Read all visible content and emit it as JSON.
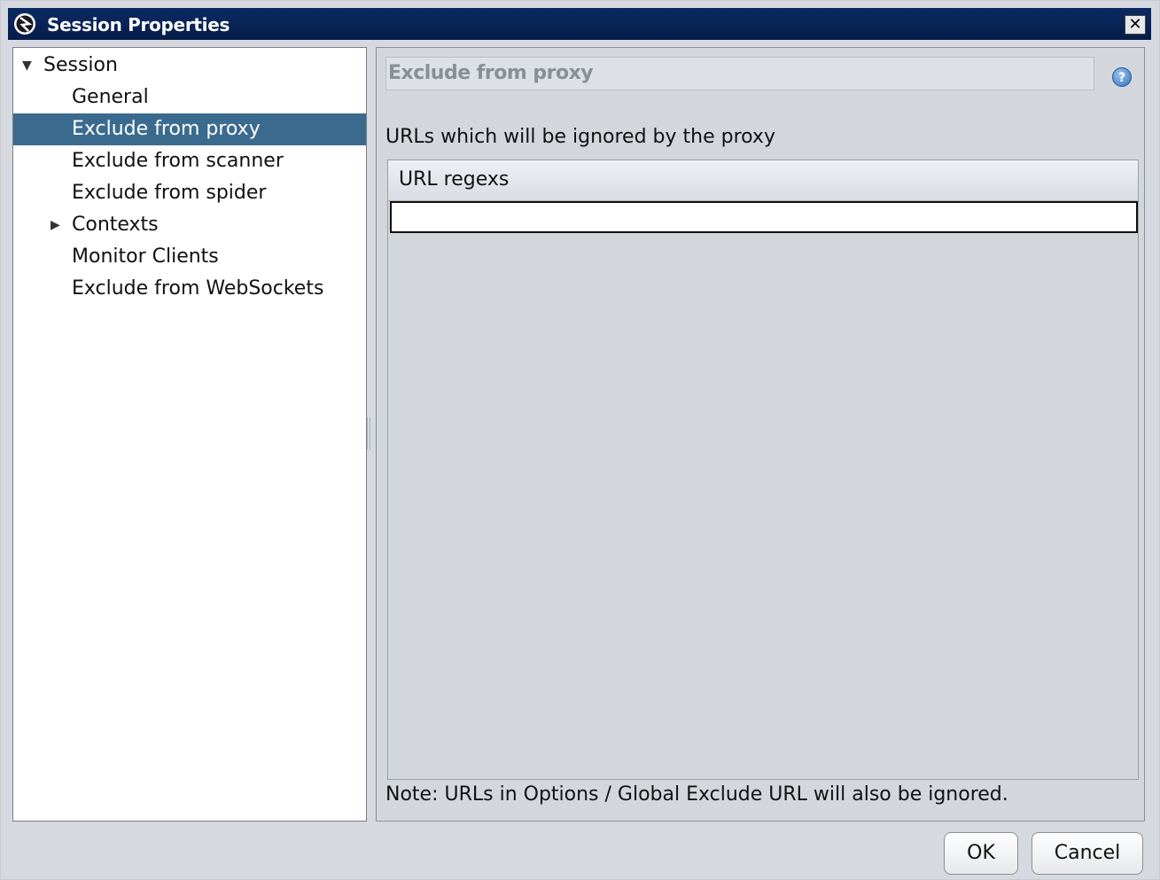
{
  "window": {
    "title": "Session Properties",
    "close_label": "✕"
  },
  "tree": {
    "items": [
      {
        "label": "Session",
        "expanded": true,
        "has_children": true
      },
      {
        "label": "General"
      },
      {
        "label": "Exclude from proxy",
        "selected": true
      },
      {
        "label": "Exclude from scanner"
      },
      {
        "label": "Exclude from spider"
      },
      {
        "label": "Contexts",
        "expanded": false,
        "has_children": true
      },
      {
        "label": "Monitor Clients"
      },
      {
        "label": "Exclude from WebSockets"
      }
    ]
  },
  "panel": {
    "title": "Exclude from proxy",
    "help_icon": "question-icon",
    "description": "URLs which will be ignored by the proxy",
    "table": {
      "columns": [
        "URL regexs"
      ],
      "rows": [
        [
          ""
        ]
      ]
    },
    "note": "Note: URLs in Options / Global Exclude URL will also be ignored."
  },
  "buttons": {
    "ok": "OK",
    "cancel": "Cancel"
  },
  "colors": {
    "titlebar": "#0b2a63",
    "selection": "#3a6b8e",
    "background": "#d6d9df"
  }
}
